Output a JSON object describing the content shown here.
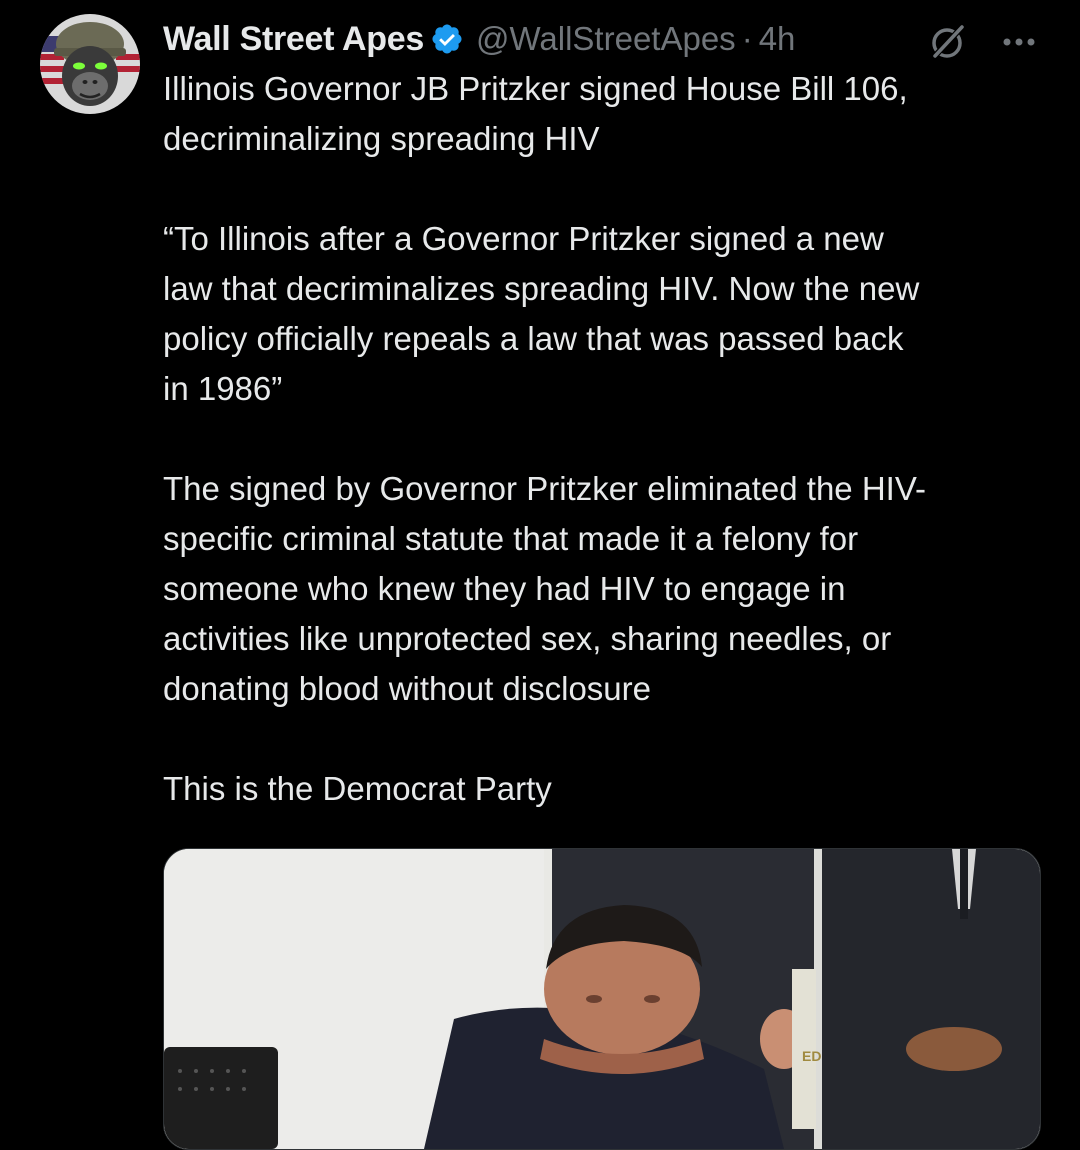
{
  "tweet": {
    "author": {
      "display_name": "Wall Street Apes",
      "handle": "@WallStreetApes",
      "verified": true,
      "avatar_icon": "gorilla-soldier-avatar"
    },
    "separator": "·",
    "time": "4h",
    "icons": {
      "grok": "grok-icon",
      "more": "more-dots-icon",
      "verified": "verified-badge-icon"
    },
    "text": {
      "line1": "Illinois Governor JB Pritzker signed House Bill 106,",
      "line2": "decriminalizing spreading HIV",
      "quote_line1": "“To Illinois after a Governor Pritzker signed a new",
      "quote_line2": "law that decriminalizes spreading HIV. Now the new",
      "quote_line3": "policy officially repeals a law that was passed back",
      "quote_line4": "in 1986”",
      "body_line1": "The signed by Governor Pritzker eliminated the HIV-",
      "body_line2": "specific criminal statute that made it a felony for",
      "body_line3": "someone who knew they had HIV to engage in",
      "body_line4": "activities like unprotected sex, sharing needles, or",
      "body_line5": "donating blood without disclosure",
      "closing": "This is the Democrat Party"
    },
    "media": {
      "type": "video-thumbnail",
      "partial_text": "ED"
    }
  },
  "colors": {
    "background": "#000000",
    "text_primary": "#e7e9ea",
    "text_secondary": "#71767b",
    "verified_blue": "#1d9bf0"
  }
}
